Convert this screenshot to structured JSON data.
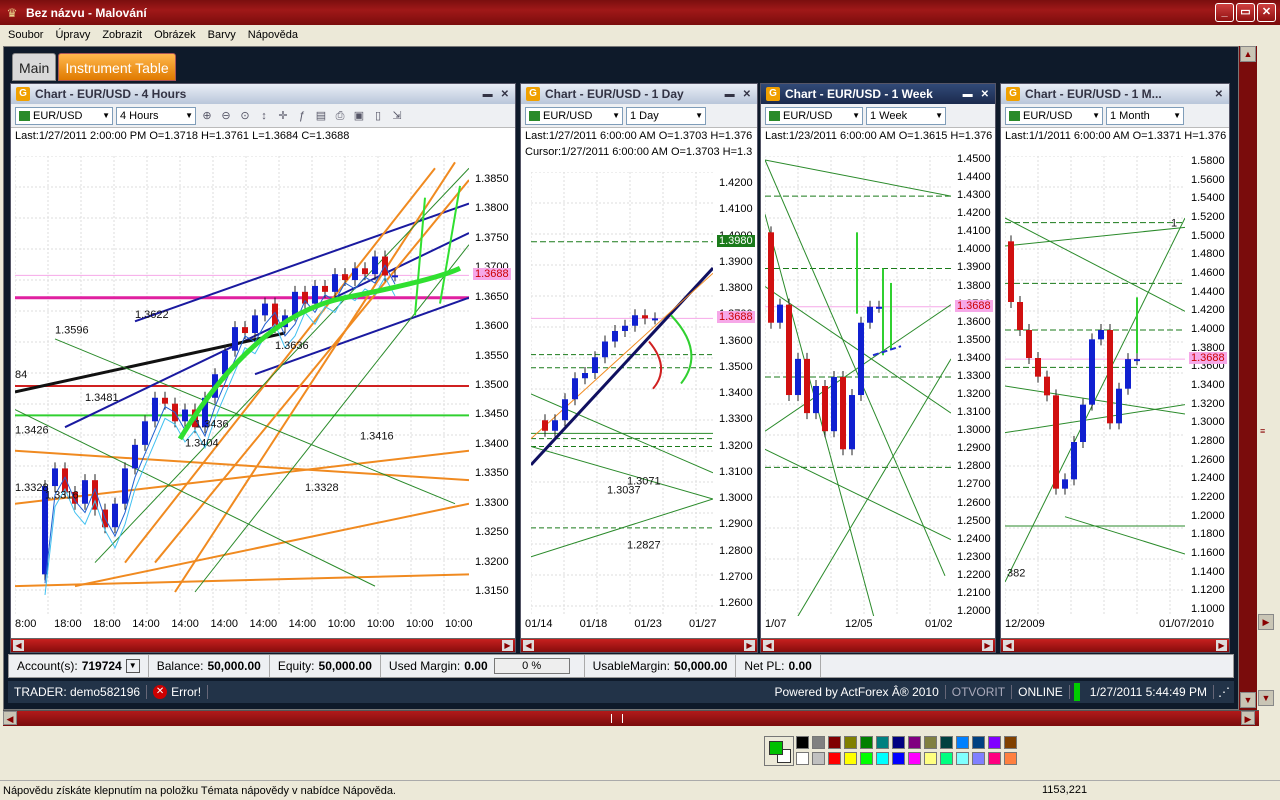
{
  "window": {
    "title": "Bez názvu - Malování",
    "btn_min": "_",
    "btn_max": "▭",
    "btn_close": "✕"
  },
  "menu": [
    "Soubor",
    "Úpravy",
    "Zobrazit",
    "Obrázek",
    "Barvy",
    "Nápověda"
  ],
  "tabs": {
    "main": "Main",
    "instrument": "Instrument Table"
  },
  "panels": [
    {
      "title": "Chart - EUR/USD - 4 Hours",
      "symbol": "EUR/USD",
      "timeframe": "4 Hours",
      "info": "Last:1/27/2011 2:00:00 PM O=1.3718 H=1.3761 L=1.3684 C=1.3688",
      "yticks": [
        "1.3850",
        "1.3800",
        "1.3750",
        "1.3700",
        "1.3650",
        "1.3600",
        "1.3550",
        "1.3500",
        "1.3450",
        "1.3400",
        "1.3350",
        "1.3300",
        "1.3250",
        "1.3200",
        "1.3150"
      ],
      "xticks": [
        "8:00",
        "18:00",
        "18:00",
        "14:00",
        "14:00",
        "14:00",
        "14:00",
        "14:00",
        "10:00",
        "10:00",
        "10:00",
        "10:00"
      ],
      "price_tag": "1.3688",
      "annotations": [
        "1.3622",
        "1.3596",
        "1.3481",
        "1.3426",
        "1.3436",
        "1.3404",
        "1.3416",
        "1.3328",
        "1.3328",
        "1.3316",
        "84",
        "1.3636"
      ]
    },
    {
      "title": "Chart - EUR/USD - 1 Day",
      "symbol": "EUR/USD",
      "timeframe": "1 Day",
      "info": "Last:1/27/2011 6:00:00 AM O=1.3703 H=1.376",
      "cursor": "Cursor:1/27/2011 6:00:00 AM O=1.3703 H=1.3",
      "yticks": [
        "1.4200",
        "1.4100",
        "1.4000",
        "1.3900",
        "1.3800",
        "1.3700",
        "1.3600",
        "1.3500",
        "1.3400",
        "1.3300",
        "1.3200",
        "1.3100",
        "1.3000",
        "1.2900",
        "1.2800",
        "1.2700",
        "1.2600"
      ],
      "xticks": [
        "01/14",
        "01/18",
        "01/23",
        "01/27"
      ],
      "price_tag": "1.3688",
      "green_tag": "1.3980",
      "annotations": [
        "1.3071",
        "1.3037",
        "1.2827"
      ]
    },
    {
      "title": "Chart - EUR/USD - 1 Week",
      "symbol": "EUR/USD",
      "timeframe": "1 Week",
      "info": "Last:1/23/2011 6:00:00 AM O=1.3615 H=1.376",
      "yticks": [
        "1.4500",
        "1.4400",
        "1.4300",
        "1.4200",
        "1.4100",
        "1.4000",
        "1.3900",
        "1.3800",
        "1.3700",
        "1.3600",
        "1.3500",
        "1.3400",
        "1.3300",
        "1.3200",
        "1.3100",
        "1.3000",
        "1.2900",
        "1.2800",
        "1.2700",
        "1.2600",
        "1.2500",
        "1.2400",
        "1.2300",
        "1.2200",
        "1.2100",
        "1.2000"
      ],
      "xticks": [
        "1/07",
        "12/05",
        "01/02"
      ],
      "price_tag": "1.3688"
    },
    {
      "title": "Chart - EUR/USD - 1 M...",
      "symbol": "EUR/USD",
      "timeframe": "1 Month",
      "info": "Last:1/1/2011 6:00:00 AM O=1.3371 H=1.376",
      "yticks": [
        "1.5800",
        "1.5600",
        "1.5400",
        "1.5200",
        "1.5000",
        "1.4800",
        "1.4600",
        "1.4400",
        "1.4200",
        "1.4000",
        "1.3800",
        "1.3600",
        "1.3400",
        "1.3200",
        "1.3000",
        "1.2800",
        "1.2600",
        "1.2400",
        "1.2200",
        "1.2000",
        "1.1800",
        "1.1600",
        "1.1400",
        "1.1200",
        "1.1000"
      ],
      "xticks": [
        "12/2009",
        "01/07/2010"
      ],
      "price_tag": "1.3688",
      "annotations": [
        "382",
        "1"
      ]
    }
  ],
  "account": {
    "accounts_label": "Account(s):",
    "account": "719724",
    "balance_label": "Balance:",
    "balance": "50,000.00",
    "equity_label": "Equity:",
    "equity": "50,000.00",
    "used_margin_label": "Used Margin:",
    "used_margin": "0.00",
    "pct": "0 %",
    "usable_label": "UsableMargin:",
    "usable": "50,000.00",
    "netpl_label": "Net PL:",
    "netpl": "0.00"
  },
  "trader": {
    "trader": "TRADER: demo582196",
    "error": "Error!",
    "powered": "Powered by ActForex Â® 2010",
    "otvorit": "OTVORIT",
    "online": "ONLINE",
    "datetime": "1/27/2011 5:44:49 PM"
  },
  "status": {
    "help": "Nápovědu získáte klepnutím na položku Témata nápovědy v nabídce Nápověda.",
    "coords": "1153,221"
  },
  "palette": {
    "fg": "#00c000",
    "bg": "#ffffff",
    "row1": [
      "#000000",
      "#808080",
      "#800000",
      "#808000",
      "#008000",
      "#008080",
      "#000080",
      "#800080",
      "#808040",
      "#004040",
      "#0080ff",
      "#004080",
      "#8000ff",
      "#804000"
    ],
    "row2": [
      "#ffffff",
      "#c0c0c0",
      "#ff0000",
      "#ffff00",
      "#00ff00",
      "#00ffff",
      "#0000ff",
      "#ff00ff",
      "#ffff80",
      "#00ff80",
      "#80ffff",
      "#8080ff",
      "#ff0080",
      "#ff8040"
    ]
  }
}
